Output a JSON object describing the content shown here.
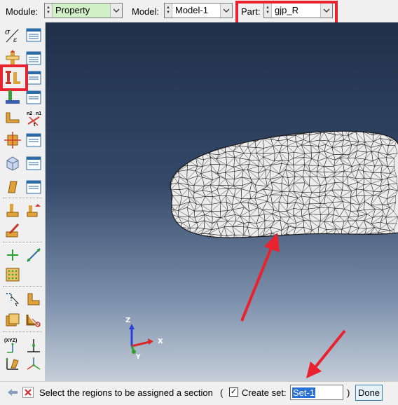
{
  "context_bar": {
    "module_label": "Module:",
    "module_value": "Property",
    "model_label": "Model:",
    "model_value": "Model-1",
    "part_label": "Part:",
    "part_value": "gjp_R"
  },
  "toolbox": {
    "icons": [
      "material-manager-icon",
      "material-list-icon",
      "section-create-icon",
      "section-list-icon",
      "assign-section-icon",
      "assignment-list-icon",
      "profile-icon",
      "profile-list-icon",
      "beam-orientation-icon",
      "normal-tangent-icon",
      "material-orientation-icon",
      "orientation-list-icon",
      "composite-layup-icon",
      "layup-list-icon",
      "skin-icon",
      "skin-list-icon",
      "special-assign-icon",
      "special-assign-2-icon",
      "special-edit-icon",
      "create-point-icon",
      "datum-axis-icon",
      "datum-grid-icon",
      "query-icon",
      "partition-icon",
      "partition-cell-icon",
      "edit-cut-icon",
      "datum-csys-icon",
      "datum-transform-icon",
      "datum-plane-icon",
      "datum-triad-icon"
    ],
    "sub_labels": {
      "n2n1t": "n2",
      "n1": "n1",
      "t": "t",
      "xyz": "(XYZ)"
    }
  },
  "viewport": {
    "triad": {
      "z_label": "Z",
      "x_label": "X",
      "y_label": "Y"
    }
  },
  "prompt_bar": {
    "prompt_text": "Select the regions to be assigned a section",
    "open_paren": "(",
    "create_set_label": "Create set:",
    "create_set_checked": true,
    "set_name": "Set-1",
    "close_paren": ")",
    "done_label": "Done"
  },
  "colors": {
    "highlight_red": "#e8222e",
    "module_field_green": "#d2f0c8",
    "mesh_face": "#ececec",
    "mesh_edge": "#1a1a1a"
  }
}
